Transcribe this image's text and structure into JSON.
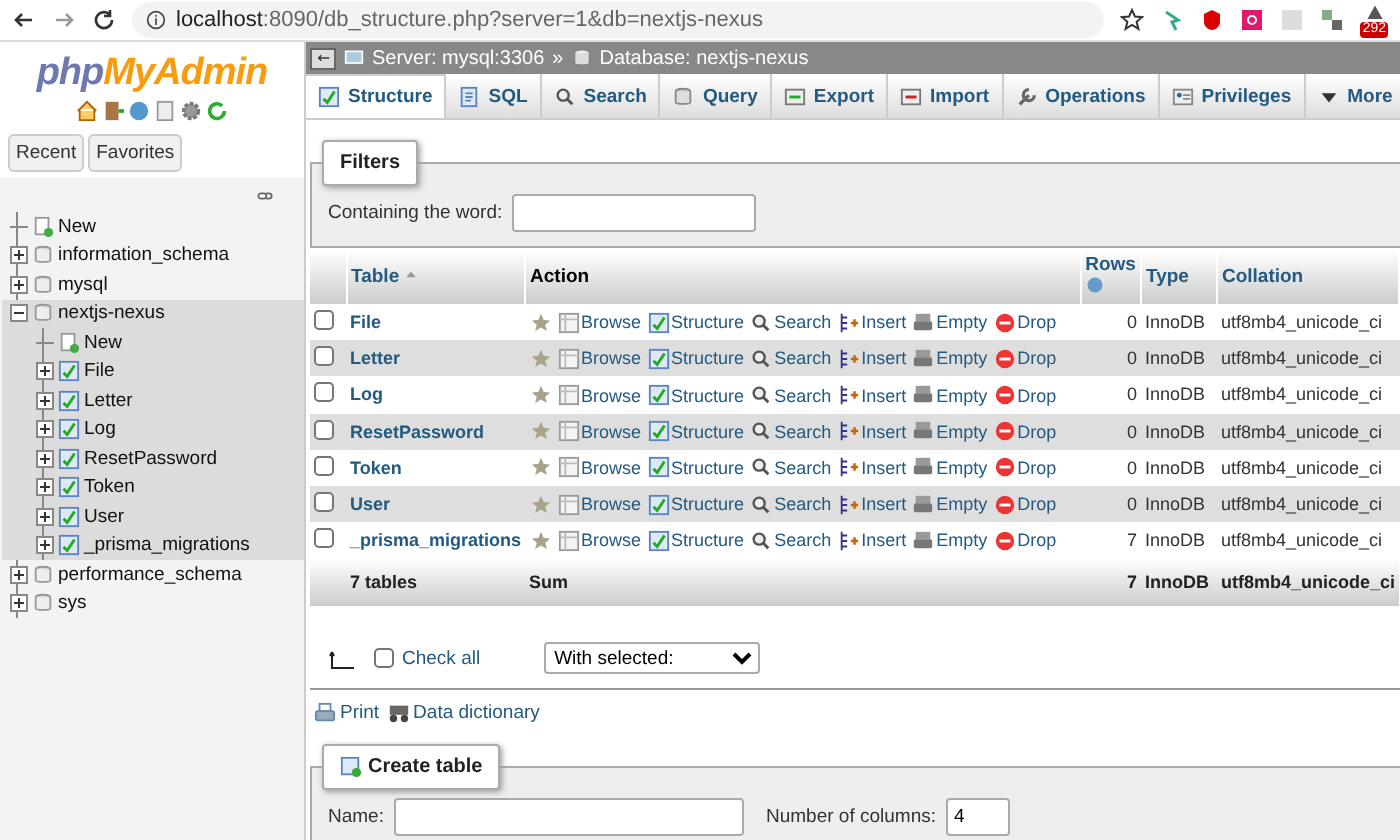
{
  "browser": {
    "host": "localhost",
    "path": ":8090/db_structure.php?server=1&db=nextjs-nexus",
    "badge": "292"
  },
  "sidebar": {
    "logo": {
      "first": "php",
      "second": "MyAdmin"
    },
    "tabs": [
      {
        "label": "Recent",
        "selected": false
      },
      {
        "label": "Favorites",
        "selected": false
      }
    ],
    "tree": [
      {
        "kind": "new",
        "label": "New"
      },
      {
        "kind": "database",
        "label": "information_schema",
        "expanded": false,
        "selected": false
      },
      {
        "kind": "database",
        "label": "mysql",
        "expanded": false,
        "selected": false
      },
      {
        "kind": "database",
        "label": "nextjs-nexus",
        "expanded": true,
        "selected": true,
        "children": [
          {
            "kind": "new",
            "label": "New"
          },
          {
            "kind": "table",
            "label": "File",
            "expanded": false
          },
          {
            "kind": "table",
            "label": "Letter",
            "expanded": false
          },
          {
            "kind": "table",
            "label": "Log",
            "expanded": false
          },
          {
            "kind": "table",
            "label": "ResetPassword",
            "expanded": false
          },
          {
            "kind": "table",
            "label": "Token",
            "expanded": false
          },
          {
            "kind": "table",
            "label": "User",
            "expanded": false
          },
          {
            "kind": "table",
            "label": "_prisma_migrations",
            "expanded": false
          }
        ]
      },
      {
        "kind": "database",
        "label": "performance_schema",
        "expanded": false,
        "selected": false
      },
      {
        "kind": "database",
        "label": "sys",
        "expanded": false,
        "selected": false
      }
    ]
  },
  "breadcrumb": {
    "server": "Server: mysql:3306",
    "separator": "»",
    "database": "Database: nextjs-nexus"
  },
  "tabs": [
    {
      "label": "Structure",
      "selected": true
    },
    {
      "label": "SQL",
      "selected": false
    },
    {
      "label": "Search",
      "selected": false
    },
    {
      "label": "Query",
      "selected": false
    },
    {
      "label": "Export",
      "selected": false
    },
    {
      "label": "Import",
      "selected": false
    },
    {
      "label": "Operations",
      "selected": false
    },
    {
      "label": "Privileges",
      "selected": false
    },
    {
      "label": "More",
      "selected": false
    }
  ],
  "filters": {
    "legend": "Filters",
    "label": "Containing the word:"
  },
  "table": {
    "columns": [
      "Table",
      "Action",
      "Rows",
      "Type",
      "Collation"
    ],
    "rows": [
      {
        "checked": false,
        "name": "File",
        "actions": [
          "Browse",
          "Structure",
          "Search",
          "Insert",
          "Empty",
          "Drop"
        ],
        "rows": "0",
        "type": "InnoDB",
        "collation": "utf8mb4_unicode_ci"
      },
      {
        "checked": false,
        "name": "Letter",
        "actions": [
          "Browse",
          "Structure",
          "Search",
          "Insert",
          "Empty",
          "Drop"
        ],
        "rows": "0",
        "type": "InnoDB",
        "collation": "utf8mb4_unicode_ci"
      },
      {
        "checked": false,
        "name": "Log",
        "actions": [
          "Browse",
          "Structure",
          "Search",
          "Insert",
          "Empty",
          "Drop"
        ],
        "rows": "0",
        "type": "InnoDB",
        "collation": "utf8mb4_unicode_ci"
      },
      {
        "checked": false,
        "name": "ResetPassword",
        "actions": [
          "Browse",
          "Structure",
          "Search",
          "Insert",
          "Empty",
          "Drop"
        ],
        "rows": "0",
        "type": "InnoDB",
        "collation": "utf8mb4_unicode_ci"
      },
      {
        "checked": false,
        "name": "Token",
        "actions": [
          "Browse",
          "Structure",
          "Search",
          "Insert",
          "Empty",
          "Drop"
        ],
        "rows": "0",
        "type": "InnoDB",
        "collation": "utf8mb4_unicode_ci"
      },
      {
        "checked": false,
        "name": "User",
        "actions": [
          "Browse",
          "Structure",
          "Search",
          "Insert",
          "Empty",
          "Drop"
        ],
        "rows": "0",
        "type": "InnoDB",
        "collation": "utf8mb4_unicode_ci"
      },
      {
        "checked": false,
        "name": "_prisma_migrations",
        "actions": [
          "Browse",
          "Structure",
          "Search",
          "Insert",
          "Empty",
          "Drop"
        ],
        "rows": "7",
        "type": "InnoDB",
        "collation": "utf8mb4_unicode_ci"
      }
    ],
    "footer": {
      "count": "7 tables",
      "label": "Sum",
      "rows": "7",
      "type": "InnoDB",
      "collation": "utf8mb4_unicode_ci"
    }
  },
  "bulk": {
    "check_all": {
      "label": "Check all",
      "checked": false
    },
    "with_selected": "With selected:"
  },
  "links": [
    "Print",
    "Data dictionary"
  ],
  "create_table": {
    "legend": "Create table",
    "name_label": "Name:",
    "columns_label": "Number of columns:",
    "columns_value": "4"
  }
}
